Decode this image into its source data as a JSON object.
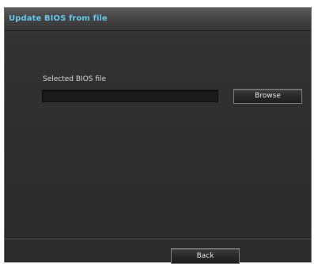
{
  "dialog": {
    "title": "Update BIOS from file"
  },
  "file_picker": {
    "label": "Selected BIOS file",
    "value": "",
    "browse_label": "Browse"
  },
  "footer": {
    "back_label": "Back"
  },
  "colors": {
    "title_accent": "#66c7ee",
    "panel_background": "#2e2e2e",
    "input_background": "#1b1b1b"
  }
}
